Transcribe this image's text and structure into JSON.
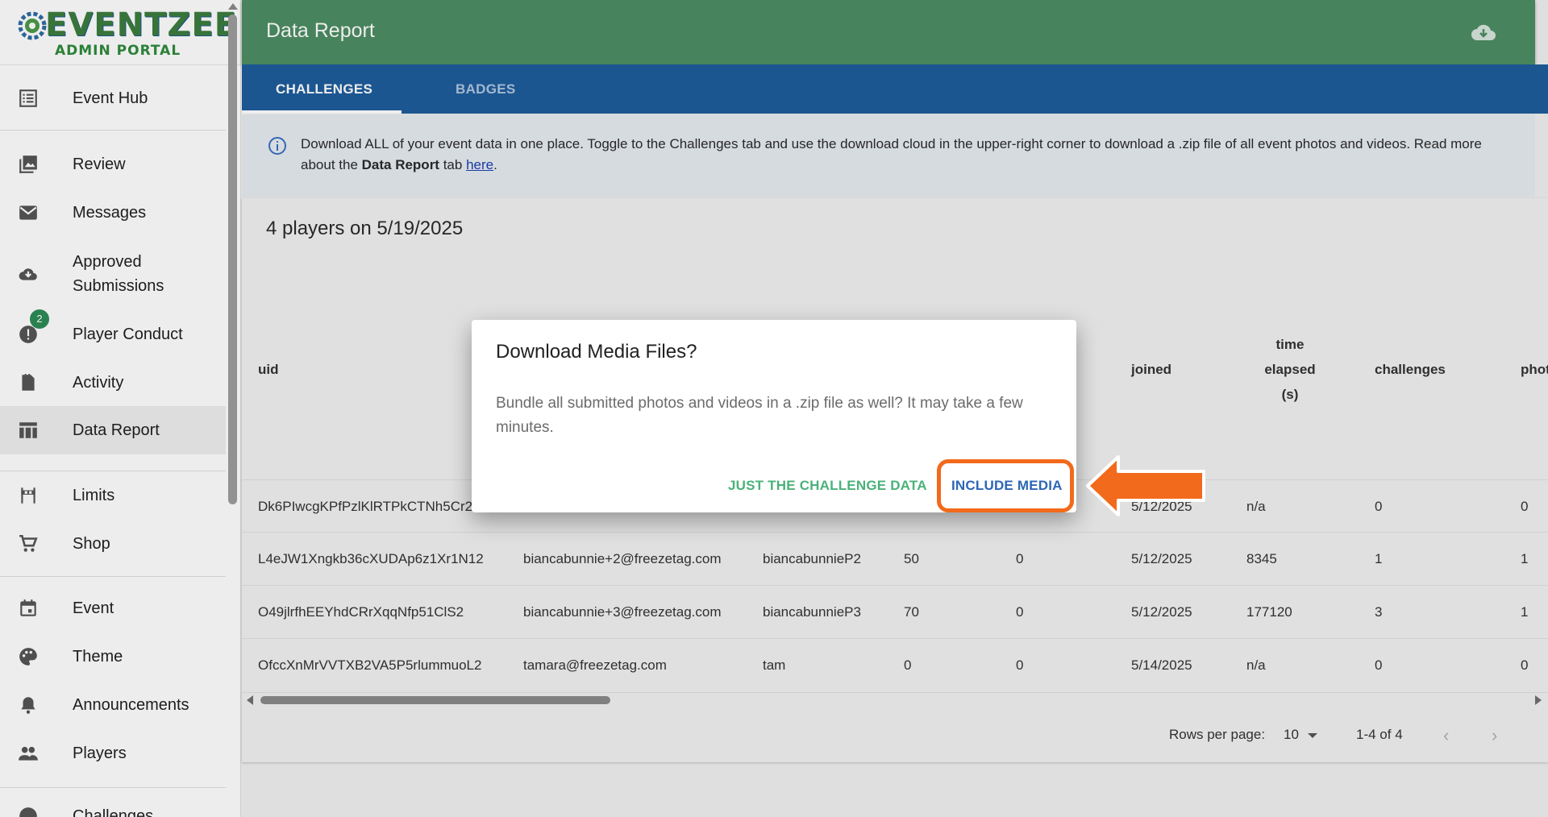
{
  "brand": {
    "name": "EVENTZEE",
    "subtitle": "ADMIN PORTAL"
  },
  "sidebar": {
    "items": [
      {
        "label": "Event Hub",
        "icon": "list-icon"
      },
      {
        "label": "Review",
        "icon": "photo-library-icon"
      },
      {
        "label": "Messages",
        "icon": "mail-icon"
      },
      {
        "label": "Approved\nSubmissions",
        "icon": "cloud-download-icon"
      },
      {
        "label": "Player Conduct",
        "icon": "alert-icon",
        "badge": "2"
      },
      {
        "label": "Activity",
        "icon": "activity-icon"
      },
      {
        "label": "Data Report",
        "icon": "table-icon",
        "active": true
      },
      {
        "label": "Limits",
        "icon": "limits-icon"
      },
      {
        "label": "Shop",
        "icon": "cart-icon"
      },
      {
        "label": "Event",
        "icon": "calendar-icon"
      },
      {
        "label": "Theme",
        "icon": "palette-icon"
      },
      {
        "label": "Announcements",
        "icon": "bell-icon"
      },
      {
        "label": "Players",
        "icon": "people-icon"
      },
      {
        "label": "Challenges",
        "icon": "challenges-icon"
      }
    ]
  },
  "header": {
    "title": "Data Report"
  },
  "tabs": [
    {
      "label": "CHALLENGES"
    },
    {
      "label": "BADGES"
    }
  ],
  "info": {
    "text_before": "Download ALL of your event data in one place. Toggle to the Challenges tab and use the download cloud in the upper-right corner to download a .zip file of all event photos and videos. Read more about the ",
    "bold": "Data Report",
    "text_mid": " tab ",
    "link": "here",
    "text_after": "."
  },
  "report": {
    "title": "4 players on 5/19/2025",
    "columns": [
      "uid",
      "joined",
      "time",
      "elapsed",
      "(s)",
      "challenges",
      "phot"
    ],
    "rows": [
      [
        "Dk6PIwcgKPfPzlKlRTPkCTNh5Cr2",
        "",
        "",
        "",
        "",
        "5/12/2025",
        "n/a",
        "0",
        "0"
      ],
      [
        "L4eJW1Xngkb36cXUDAp6z1Xr1N12",
        "biancabunnie+2@freezetag.com",
        "biancabunnieP2",
        "50",
        "0",
        "5/12/2025",
        "8345",
        "1",
        "1"
      ],
      [
        "O49jlrfhEEYhdCRrXqqNfp51ClS2",
        "biancabunnie+3@freezetag.com",
        "biancabunnieP3",
        "70",
        "0",
        "5/12/2025",
        "177120",
        "3",
        "1"
      ],
      [
        "OfccXnMrVVTXB2VA5P5rlummuoL2",
        "tamara@freezetag.com",
        "tam",
        "0",
        "0",
        "5/14/2025",
        "n/a",
        "0",
        "0"
      ]
    ]
  },
  "pagination": {
    "rows_label": "Rows per page:",
    "rows_value": "10",
    "range": "1-4 of 4",
    "prev": "‹",
    "next": "›"
  },
  "dialog": {
    "title": "Download Media Files?",
    "body": "Bundle all submitted photos and videos in a .zip file as well? It may take a few minutes.",
    "cancel_label": "JUST THE CHALLENGE DATA",
    "confirm_label": "INCLUDE MEDIA"
  },
  "colors": {
    "header_green": "#4d8d63",
    "tabs_blue": "#1f5d9d",
    "highlight_orange": "#f26a1b",
    "confirm_blue": "#2d66b6",
    "cancel_green": "#49b27a"
  }
}
